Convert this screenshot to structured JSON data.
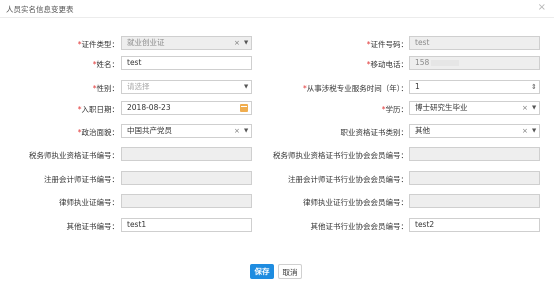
{
  "dialog": {
    "title": "人员实名信息变更表",
    "close_glyph": "×"
  },
  "fields": {
    "cert_type": {
      "label": "证件类型：",
      "value": "就业创业证"
    },
    "cert_no": {
      "label": "证件号码：",
      "value": "test"
    },
    "name": {
      "label": "姓名：",
      "value": "test"
    },
    "mobile": {
      "label": "移动电话：",
      "value": "158"
    },
    "gender": {
      "label": "性别：",
      "placeholder": "请选择"
    },
    "service_years": {
      "label": "从事涉税专业服务时间（年）：",
      "value": "1"
    },
    "join_date": {
      "label": "入职日期：",
      "value": "2018-08-23"
    },
    "education": {
      "label": "学历：",
      "value": "博士研究生毕业"
    },
    "political": {
      "label": "政治面貌：",
      "value": "中国共产党员"
    },
    "qual_type": {
      "label": "职业资格证书类别：",
      "value": "其他"
    },
    "tax_cert_no": {
      "label": "税务师执业资格证书编号：",
      "value": ""
    },
    "tax_assoc_no": {
      "label": "税务师执业资格证书行业协会会员编号：",
      "value": ""
    },
    "cpa_cert_no": {
      "label": "注册会计师证书编号：",
      "value": ""
    },
    "cpa_assoc_no": {
      "label": "注册会计师证书行业协会会员编号：",
      "value": ""
    },
    "lawyer_cert_no": {
      "label": "律师执业证编号：",
      "value": ""
    },
    "lawyer_assoc_no": {
      "label": "律师执业证行业协会会员编号：",
      "value": ""
    },
    "other_cert_no": {
      "label": "其他证书编号：",
      "value": "test1"
    },
    "other_assoc_no": {
      "label": "其他证书行业协会会员编号：",
      "value": "test2"
    }
  },
  "glyphs": {
    "required": "*",
    "clear": "×",
    "dropdown": "▼",
    "spinner": "⇕"
  },
  "buttons": {
    "save": "保存",
    "cancel": "取消"
  },
  "colors": {
    "required": "#e23434",
    "primary": "#1e8ce0",
    "disabled_bg": "#eeeeee",
    "calendar": "#f0ad4e"
  }
}
